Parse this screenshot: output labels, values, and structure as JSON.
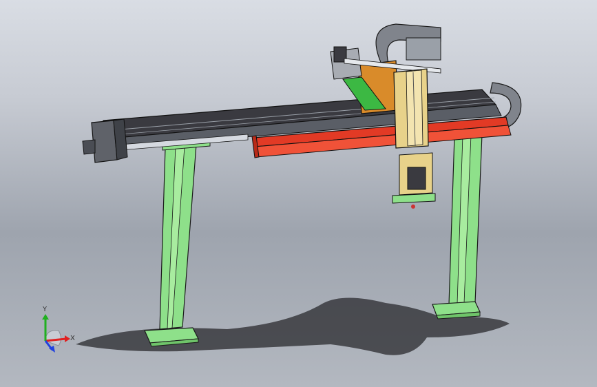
{
  "viewport": {
    "background_top": "#d9dde4",
    "background_bottom": "#a5abb4"
  },
  "model": {
    "frame_color": "#8ee08a",
    "beam_color": "#2e2e33",
    "rail_color": "#e23a25",
    "carriage_color": "#d98b2a",
    "vertical_axis_color": "#e8d28a",
    "cable_chain_color": "#7a7e86"
  },
  "triad": {
    "x_label": "X",
    "y_label": "Y",
    "x_color": "#e02020",
    "y_color": "#20b020",
    "z_color": "#2040e0"
  }
}
